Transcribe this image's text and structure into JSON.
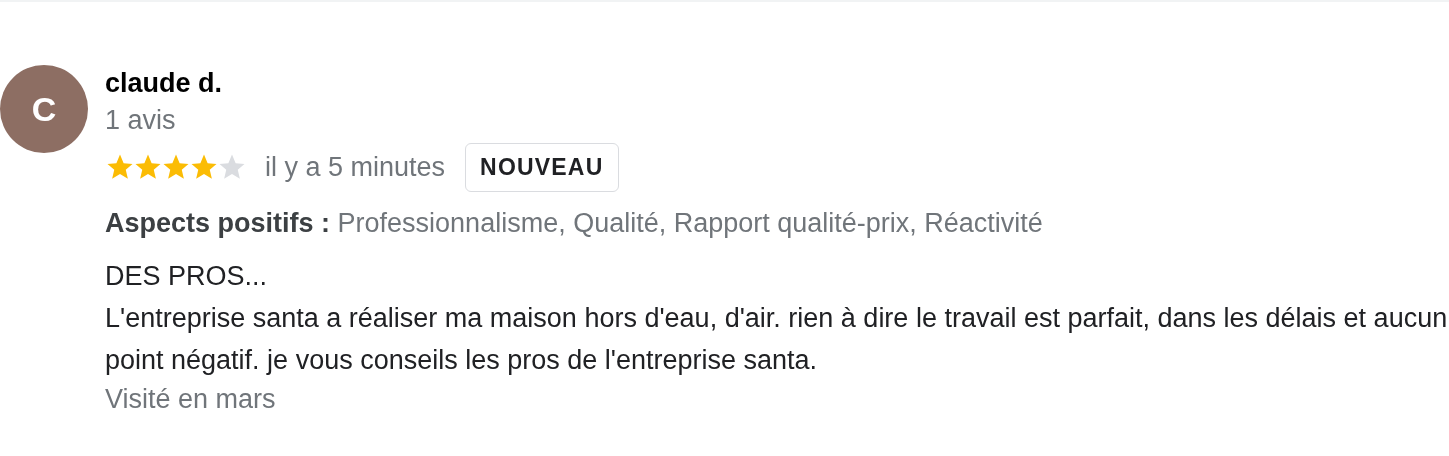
{
  "review": {
    "avatar_letter": "C",
    "author": "claude d.",
    "review_count": "1 avis",
    "stars": 4,
    "time": "il y a 5 minutes",
    "badge": "NOUVEAU",
    "highlights_label": "Aspects positifs :",
    "highlights": "Professionnalisme, Qualité, Rapport qualité-prix, Réactivité",
    "title": "DES PROS...",
    "text": "L'entreprise santa a réaliser ma maison hors d'eau, d'air. rien à dire le travail est parfait, dans les délais et aucun point négatif. je vous conseils les pros de l'entreprise santa.",
    "visited": "Visité en mars"
  }
}
